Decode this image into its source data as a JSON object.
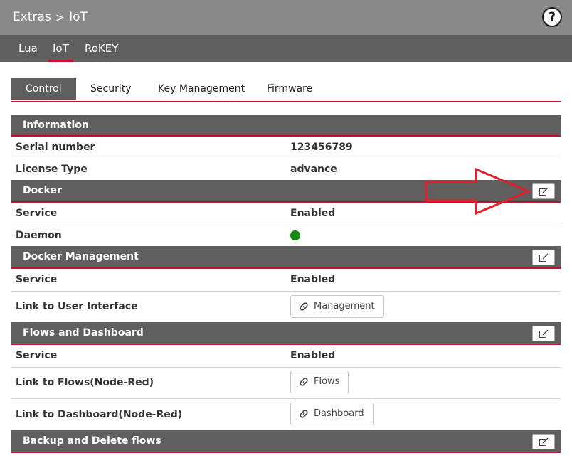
{
  "breadcrumb": {
    "parent": "Extras",
    "separator": ">",
    "current": "IoT"
  },
  "help_label": "?",
  "subnav": {
    "items": [
      "Lua",
      "IoT",
      "RoKEY"
    ],
    "active": "IoT"
  },
  "tabs": {
    "items": [
      "Control",
      "Security",
      "Key Management",
      "Firmware"
    ],
    "active": "Control"
  },
  "information": {
    "title": "Information",
    "serial_label": "Serial number",
    "serial_value": "123456789",
    "license_label": "License Type",
    "license_value": "advance"
  },
  "docker": {
    "title": "Docker",
    "service_label": "Service",
    "service_value": "Enabled",
    "daemon_label": "Daemon",
    "daemon_status_color": "#108a10"
  },
  "docker_management": {
    "title": "Docker Management",
    "service_label": "Service",
    "service_value": "Enabled",
    "link_label": "Link to User Interface",
    "link_button": "Management"
  },
  "flows_dashboard": {
    "title": "Flows and Dashboard",
    "service_label": "Service",
    "service_value": "Enabled",
    "flows_label": "Link to Flows(Node-Red)",
    "flows_button": "Flows",
    "dashboard_label": "Link to Dashboard(Node-Red)",
    "dashboard_button": "Dashboard"
  },
  "backup": {
    "title": "Backup and Delete flows"
  },
  "colors": {
    "accent": "#c8102e",
    "header": "#5f5f5f",
    "topbar": "#8a8a8a",
    "annotation_arrow": "#e0202a"
  }
}
